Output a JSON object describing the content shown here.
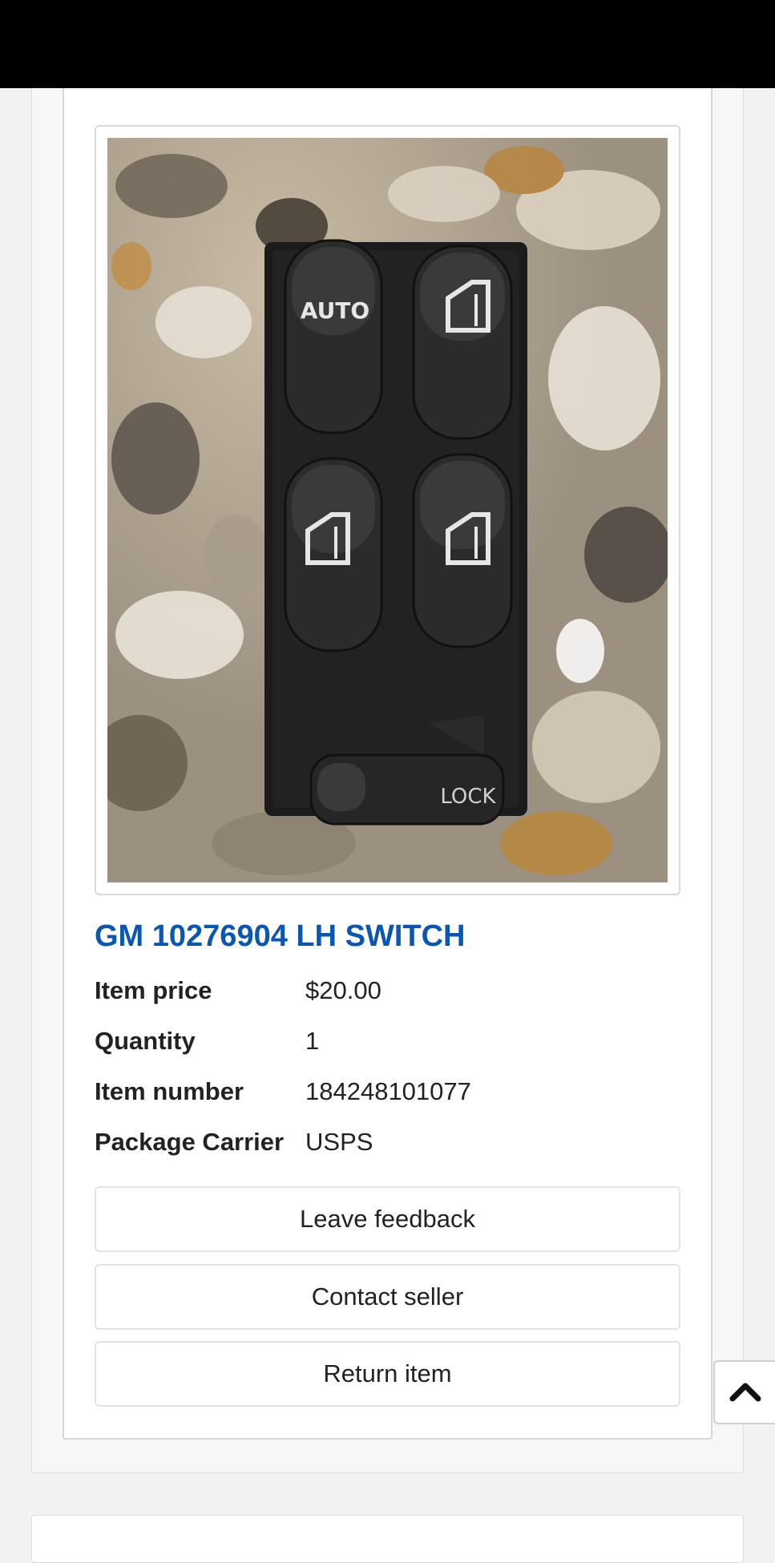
{
  "product": {
    "title": "GM 10276904 LH SWITCH",
    "image_alt": "Black power window switch with AUTO and LOCK buttons on granite countertop",
    "photo_text": {
      "auto": "AUTO",
      "lock": "LOCK"
    }
  },
  "details": [
    {
      "label": "Item price",
      "value": "$20.00"
    },
    {
      "label": "Quantity",
      "value": "1"
    },
    {
      "label": "Item number",
      "value": "184248101077"
    },
    {
      "label": "Package Carrier",
      "value": "USPS"
    }
  ],
  "actions": {
    "leave_feedback": "Leave feedback",
    "contact_seller": "Contact seller",
    "return_item": "Return item"
  },
  "colors": {
    "title": "#0a56b0",
    "status_bar": "#000000"
  },
  "icons": {
    "scroll_top": "chevron-up-icon"
  }
}
